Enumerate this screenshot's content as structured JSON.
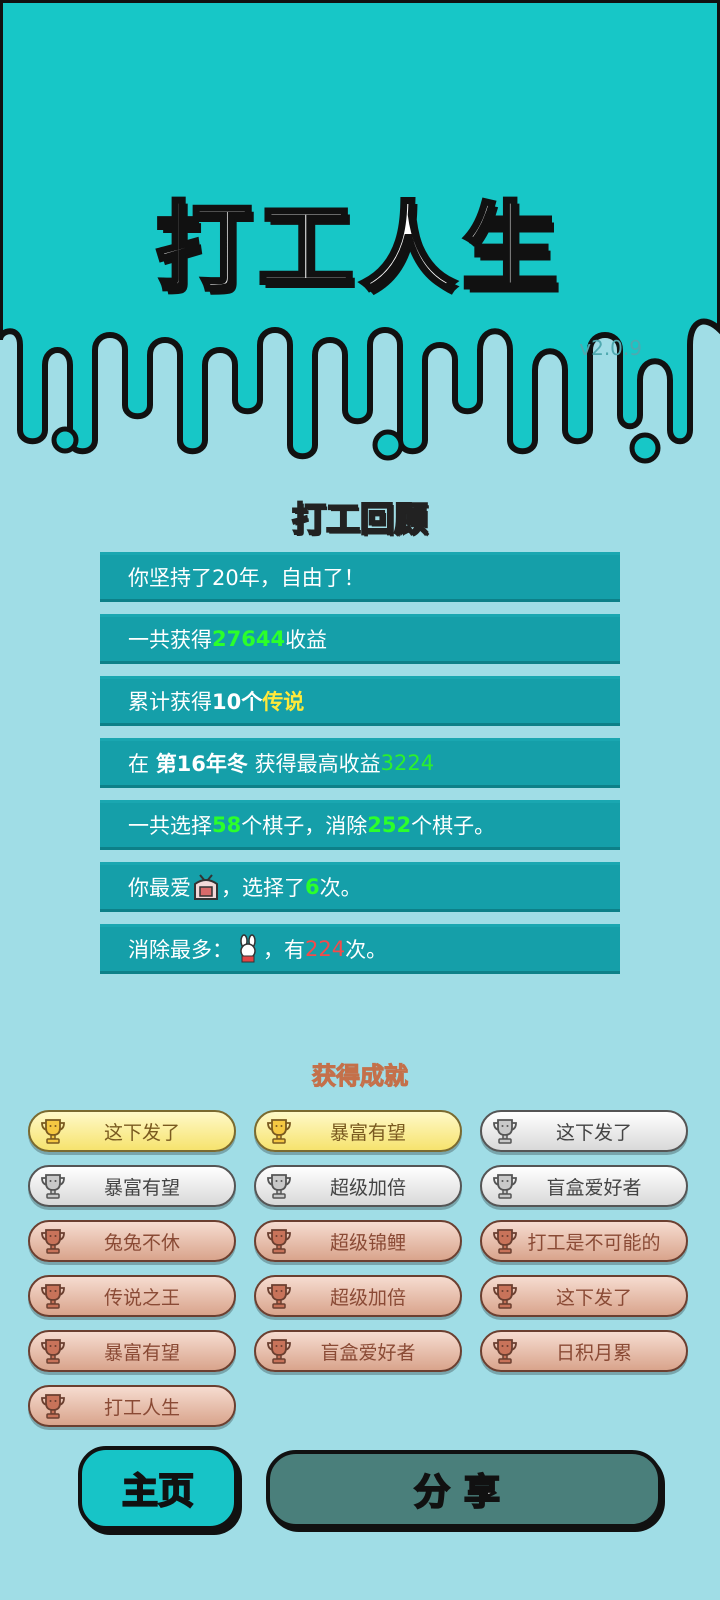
{
  "header": {
    "game_title": "打工人生",
    "version": "v2.0.9"
  },
  "review": {
    "title": "打工回顾",
    "line1": "你坚持了20年，自由了！",
    "line2": {
      "pre": "一共获得",
      "value": "27644",
      "post": "收益"
    },
    "line3": {
      "pre": "累计获得",
      "count": "10个",
      "highlight": "传说"
    },
    "line4": {
      "pre": "在 ",
      "season": "第16年冬",
      "mid": " 获得最高收益",
      "value": "3224"
    },
    "line5": {
      "pre": "一共选择",
      "chosen": "58",
      "mid": "个棋子，消除",
      "removed": "252",
      "post": "个棋子。"
    },
    "line6": {
      "pre": "你最爱",
      "icon": "tv-box-icon",
      "mid": "，选择了",
      "count": "6",
      "post": "次。"
    },
    "line7": {
      "pre": "消除最多：",
      "icon": "rabbit-icon",
      "mid": "，有",
      "count": "224",
      "post": "次。"
    }
  },
  "achievements": {
    "title": "获得成就",
    "items": [
      {
        "label": "这下发了",
        "tier": "gold"
      },
      {
        "label": "暴富有望",
        "tier": "gold"
      },
      {
        "label": "这下发了",
        "tier": "silver"
      },
      {
        "label": "暴富有望",
        "tier": "silver"
      },
      {
        "label": "超级加倍",
        "tier": "silver"
      },
      {
        "label": "盲盒爱好者",
        "tier": "silver"
      },
      {
        "label": "兔兔不休",
        "tier": "bronze"
      },
      {
        "label": "超级锦鲤",
        "tier": "bronze"
      },
      {
        "label": "打工是不可能的",
        "tier": "bronze"
      },
      {
        "label": "传说之王",
        "tier": "bronze"
      },
      {
        "label": "超级加倍",
        "tier": "bronze"
      },
      {
        "label": "这下发了",
        "tier": "bronze"
      },
      {
        "label": "暴富有望",
        "tier": "bronze"
      },
      {
        "label": "盲盒爱好者",
        "tier": "bronze"
      },
      {
        "label": "日积月累",
        "tier": "bronze"
      },
      {
        "label": "打工人生",
        "tier": "bronze"
      }
    ]
  },
  "buttons": {
    "home": "主页",
    "share": "分享"
  },
  "colors": {
    "header_teal": "#17c7c7",
    "background": "#a0dde6",
    "stat_bar": "#159fa9",
    "highlight_green": "#2bff2b",
    "highlight_yellow": "#ffe93a",
    "highlight_red": "#f54a4a"
  }
}
